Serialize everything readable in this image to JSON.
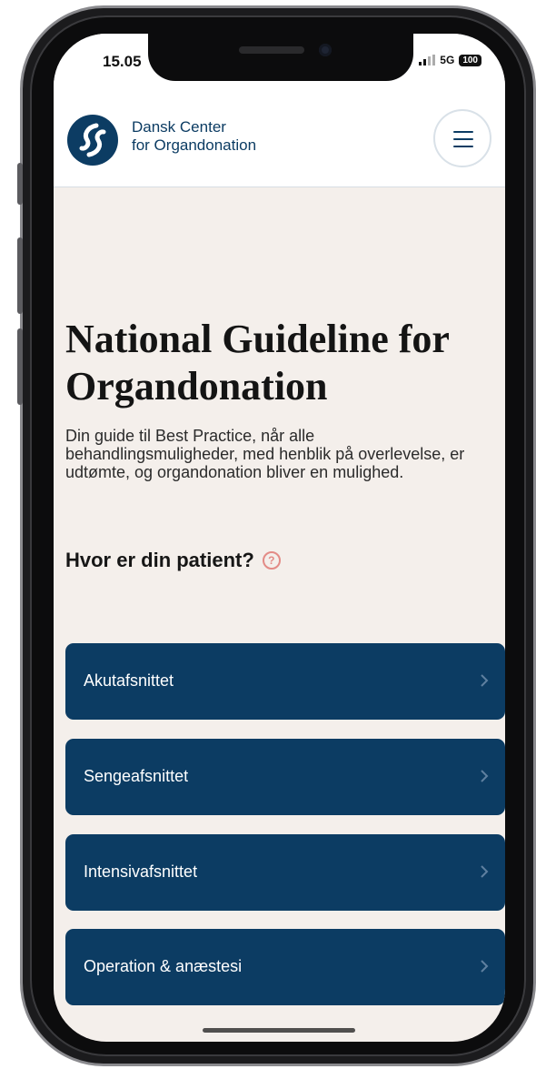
{
  "status_bar": {
    "time": "15.05",
    "network": "5G",
    "battery": "100"
  },
  "header": {
    "logo_line1": "Dansk Center",
    "logo_line2": "for Organdonation",
    "logo_icon": "dcfo-logo-icon",
    "menu_icon": "hamburger-menu-icon"
  },
  "main": {
    "title": "National Guideline for Organdonation",
    "subtitle": "Din guide til Best Practice, når alle behandlingsmuligheder, med henblik på overlevelse, er udtømte, og organdonation bliver en mulighed.",
    "question": "Hvor er din patient?",
    "help_icon": "help-circle-icon",
    "options": [
      {
        "label": "Akutafsnittet"
      },
      {
        "label": "Sengeafsnittet"
      },
      {
        "label": "Intensivafsnittet"
      },
      {
        "label": "Operation & anæstesi"
      }
    ]
  },
  "colors": {
    "brand_navy": "#0c3c63",
    "page_background": "#f4efeb",
    "help_accent": "#e38b86"
  }
}
